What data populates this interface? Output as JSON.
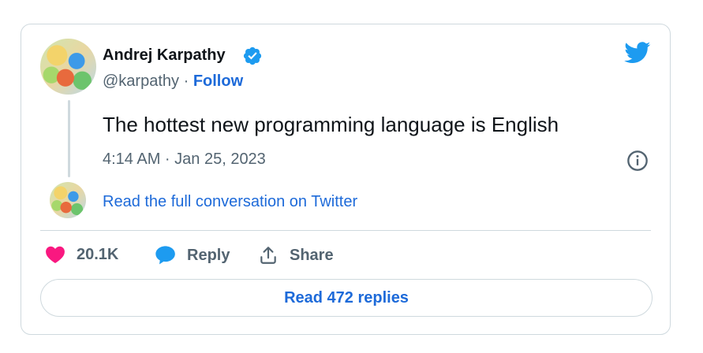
{
  "author": {
    "name": "Andrej Karpathy",
    "handle": "@karpathy",
    "separator": "·",
    "follow_label": "Follow"
  },
  "tweet": {
    "text": "The hottest new programming language is English",
    "timestamp": "4:14 AM · Jan 25, 2023"
  },
  "conversation_link": "Read the full conversation on Twitter",
  "actions": {
    "likes": "20.1K",
    "reply_label": "Reply",
    "share_label": "Share"
  },
  "read_replies_label": "Read 472 replies",
  "icons": {
    "brand": "twitter-bird-icon",
    "verified": "verified-badge-icon",
    "info": "info-icon",
    "like": "heart-icon",
    "reply": "speech-bubble-icon",
    "share": "share-upload-icon"
  },
  "colors": {
    "brand_blue": "#1d9bf0",
    "link_blue": "#1d6ad9",
    "like_pink": "#f91880",
    "text_secondary": "#536471",
    "border": "#cfd9de"
  }
}
